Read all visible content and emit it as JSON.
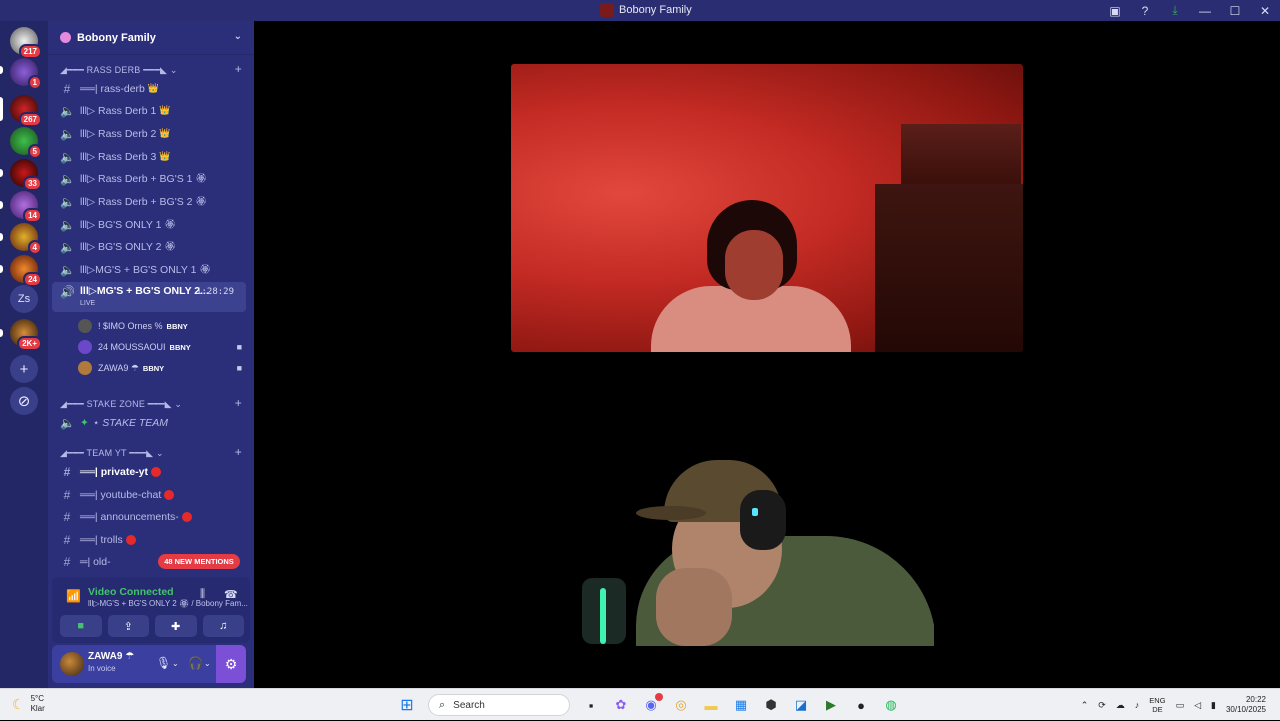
{
  "window": {
    "title": "Bobony Family",
    "icons": [
      "inbox-icon",
      "help-icon",
      "download-icon"
    ],
    "controls": [
      "—",
      "☐",
      "✕"
    ]
  },
  "server_rail": [
    {
      "name": "server-1",
      "badge": "217"
    },
    {
      "name": "server-2",
      "badge": "1"
    },
    {
      "name": "server-3",
      "badge": "267"
    },
    {
      "name": "server-4",
      "badge": "5"
    },
    {
      "name": "server-5",
      "badge": "33"
    },
    {
      "name": "server-6",
      "badge": "14"
    },
    {
      "name": "server-7",
      "badge": "4"
    },
    {
      "name": "server-8",
      "badge": "24"
    },
    {
      "name": "server-zs",
      "label": "Zs"
    },
    {
      "name": "server-9",
      "badge": "2K+"
    }
  ],
  "server": {
    "name": "Bobony Family"
  },
  "categories": {
    "rass": "◢━━━ RASS DERB ━━━◣ ⌄",
    "stake": "◢━━━ STAKE ZONE ━━━◣ ⌄",
    "team": "◢━━━ TEAM YT ━━━◣ ⌄"
  },
  "channels": {
    "rass_derb_text": "══| rass-derb",
    "rass_derb_1": "lll▷ Rass Derb 1",
    "rass_derb_2": "lll▷ Rass Derb 2",
    "rass_derb_3": "lll▷ Rass Derb 3",
    "rass_bg_1": "lll▷ Rass Derb + BG'S 1",
    "rass_bg_2": "lll▷ Rass Derb + BG'S 2",
    "bg_only_1": "lll▷ BG'S ONLY 1",
    "bg_only_2": "lll▷ BG'S ONLY 2",
    "mg_bg_1": "lll▷MG'S + BG'S ONLY 1",
    "mg_bg_2": "lll▷MG'S + BG'S ONLY 2...",
    "mg_bg_2_time": "1:28:29",
    "live_label": "LIVE",
    "stake_team": "⋆ STAKE TEAM",
    "private_yt": "══| private-yt",
    "youtube_chat": "══| youtube-chat",
    "announcements": "══| announcements-",
    "trolls": "══| trolls",
    "old": "═| old-"
  },
  "voice_users": [
    {
      "name": "! $IMO Ornes %",
      "tag": "BBNY",
      "cam": false
    },
    {
      "name": "24 MOUSSAOUI",
      "tag": "BBNY",
      "cam": true
    },
    {
      "name": "ZAWA9 ☂",
      "tag": "BBNY",
      "cam": true
    }
  ],
  "mentions_pill": "48 NEW MENTIONS",
  "voice_panel": {
    "status": "Video Connected",
    "location": "lll▷MG'S + BG'S ONLY 2 🏵 / Bobony Fam..."
  },
  "user_panel": {
    "name": "ZAWA9 ☂",
    "status": "In voice"
  },
  "taskbar": {
    "temp": "5°C",
    "weather": "Klar",
    "search_placeholder": "Search",
    "lang_1": "ENG",
    "lang_2": "DE",
    "time": "20:22",
    "date": "30/10/2025"
  },
  "colors": {
    "titlebar": "#2a2d72",
    "sidebar": "#2b2f7a",
    "rail": "#232766",
    "accent_green": "#43c36e",
    "mention_red": "#e43b44"
  }
}
